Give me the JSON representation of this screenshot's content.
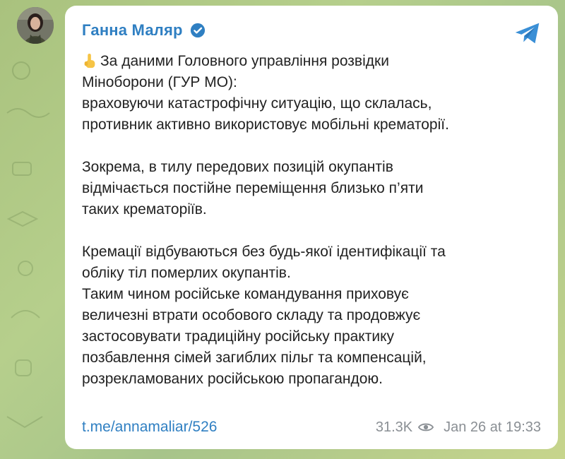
{
  "post": {
    "author": "Ганна Маляр",
    "views": "31.3K",
    "timestamp": "Jan 26 at 19:33",
    "link": "t.me/annamaliar/526",
    "lines": [
      "За даними Головного управління розвідки",
      "Міноборони (ГУР МО):",
      "враховуючи катастрофічну ситуацію, що склалась,",
      "противник активно використовує мобільні крематорії.",
      "Зокрема, в тилу передових позицій окупантів",
      "відмічається постійне переміщення близько п’яти",
      "таких крематоріїв.",
      "Кремації відбуваються без будь-якої ідентифікації та",
      "обліку тіл померлих окупантів.",
      "Таким чином російське командування приховує",
      "величезні втрати особового складу та продовжує",
      "застосовувати традиційну російську практику",
      "позбавлення сімей загиблих пільг та компенсацій,",
      "розрекламованих російською пропагандою."
    ]
  },
  "icons": {
    "avatar": "profile-photo",
    "verified": "verified-badge-icon",
    "telegram": "telegram-plane-icon",
    "views": "eye-icon",
    "emoji": "index-pointing-up-emoji"
  },
  "colors": {
    "accent": "#2f7fc2",
    "text": "#222222",
    "meta": "#8a8f94",
    "background": "#b6cf8c"
  }
}
